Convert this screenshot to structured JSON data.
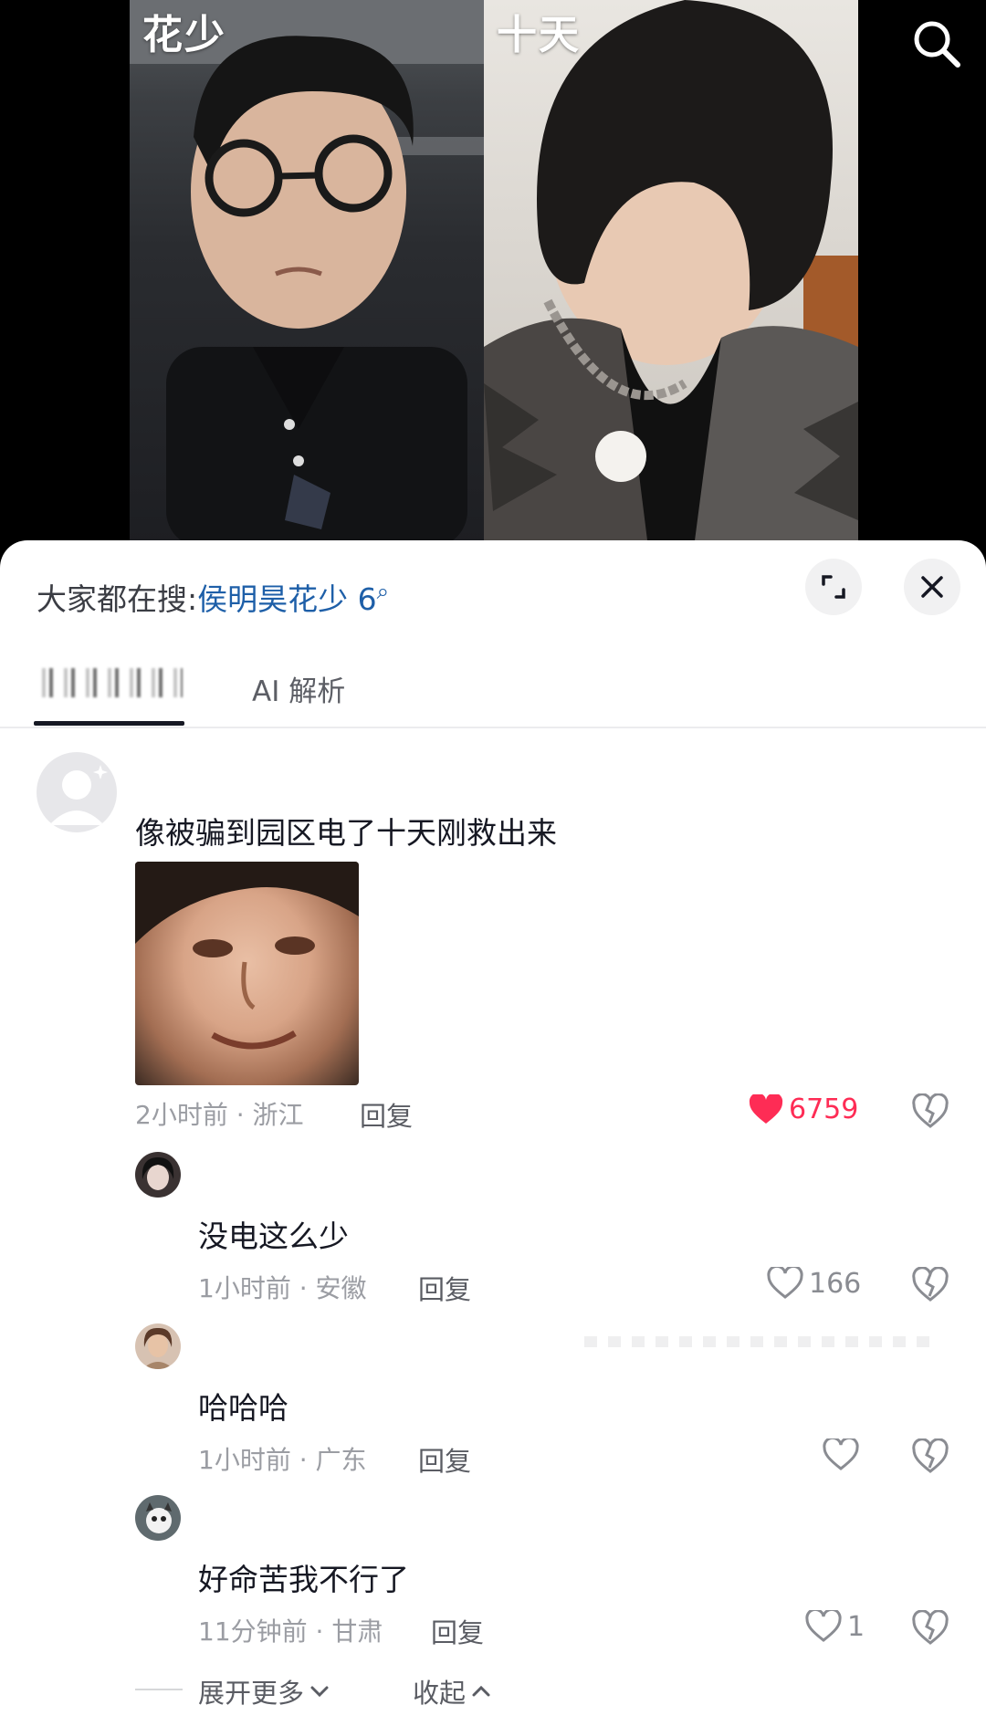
{
  "video": {
    "left_label": "花少",
    "right_label": "十天"
  },
  "sheet": {
    "search_prefix": "大家都在搜:",
    "search_term": "侯明昊花少 6",
    "tabs": {
      "active_blurred": "",
      "ai": "AI 解析"
    }
  },
  "comments": {
    "main": {
      "text": "像被骗到园区电了十天刚救出来",
      "time_location": "2小时前 · 浙江",
      "reply_label": "回复",
      "likes": "6759"
    },
    "replies": [
      {
        "text": "没电这么少",
        "time_location": "1小时前 · 安徽",
        "reply_label": "回复",
        "likes": "166"
      },
      {
        "text": "哈哈哈",
        "time_location": "1小时前 · 广东",
        "reply_label": "回复",
        "likes": ""
      },
      {
        "text": "好命苦我不行了",
        "time_location": "11分钟前 · 甘肃",
        "reply_label": "回复",
        "likes": "1"
      }
    ],
    "expand_more": "展开更多",
    "collapse": "收起"
  },
  "colors": {
    "like_red": "#fe2c55",
    "link_blue": "#1e5fa8"
  }
}
